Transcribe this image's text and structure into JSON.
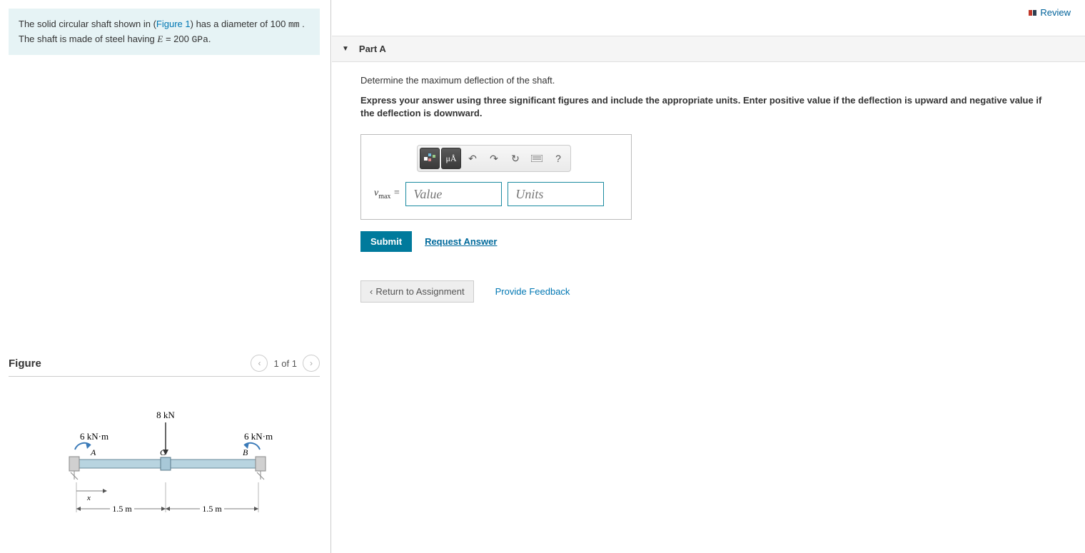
{
  "review": "Review",
  "problem": {
    "pre": "The solid circular shaft shown in (",
    "figlink": "Figure 1",
    "mid": ") has a diameter of 100 ",
    "mm": "mm",
    "post1": " . The shaft is made of steel having ",
    "evar": "E",
    "eq": " = 200 ",
    "gpa": "GPa",
    "end": "."
  },
  "figure": {
    "title": "Figure",
    "pager": "1 of 1",
    "labels": {
      "force": "8 kN",
      "moment_left": "6 kN·m",
      "moment_right": "6 kN·m",
      "ptA": "A",
      "ptB": "B",
      "ptC": "C",
      "x": "x",
      "span_left": "1.5 m",
      "span_right": "1.5 m"
    }
  },
  "partA": {
    "title": "Part A",
    "prompt": "Determine the maximum deflection of the shaft.",
    "instruct": "Express your answer using three significant figures and include the appropriate units. Enter positive value if the deflection is upward and negative value if the deflection is downward.",
    "var": "v",
    "sub": "max",
    "value_ph": "Value",
    "units_ph": "Units",
    "submit": "Submit",
    "request": "Request Answer",
    "muA": "μÅ",
    "help": "?"
  },
  "bottom": {
    "return": "Return to Assignment",
    "feedback": "Provide Feedback"
  }
}
